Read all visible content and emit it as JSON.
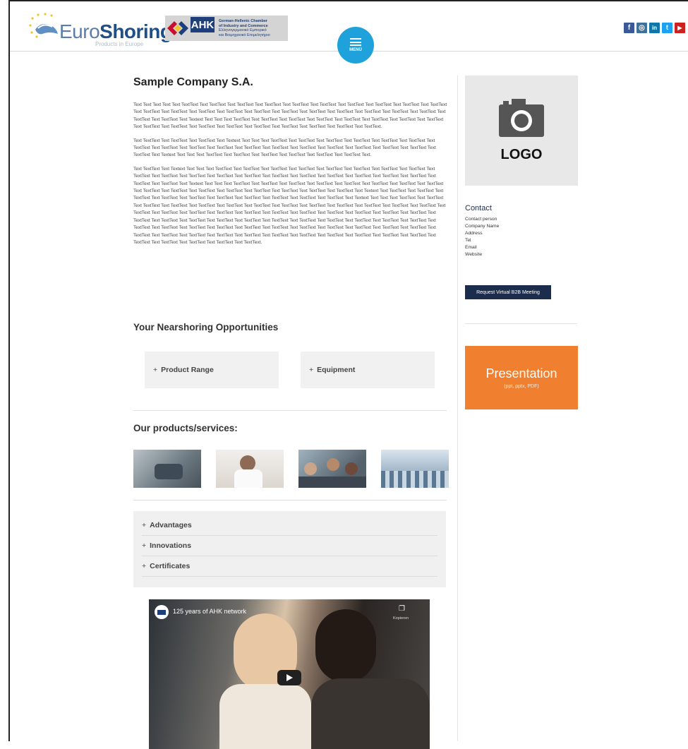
{
  "header": {
    "brand_euro": "Euro",
    "brand_shoring": "Shoring",
    "brand_tagline": "Products in Europe",
    "ahk_label": "AHK",
    "ahk_text_1": "German-Hellenic Chamber",
    "ahk_text_2": "of Industry and Commerce",
    "ahk_text_3": "Ελληνογερμανικό Εμπορικό",
    "ahk_text_4": "και Βιομηχανικό Επιμελητήριο",
    "menu_label": "MENÜ",
    "social": [
      {
        "icon": "facebook-icon",
        "glyph": "f",
        "color": "#3b5998"
      },
      {
        "icon": "instagram-icon",
        "glyph": "◎",
        "color": "#3f729b"
      },
      {
        "icon": "linkedin-icon",
        "glyph": "in",
        "color": "#0e76a8"
      },
      {
        "icon": "twitter-icon",
        "glyph": "t",
        "color": "#1da1f2"
      },
      {
        "icon": "youtube-icon",
        "glyph": "▶",
        "color": "#cd201f"
      }
    ]
  },
  "company": {
    "name": "Sample Company S.A.",
    "paragraphs": [
      "Text Text Text Text Text TextText Text TextText Text TextText Text TextText Text TextText Text TextText Text TextText Text TextText Text TextText Text TextText Text TextText Text TextText Text TextText Text TextText Text TextText Text TextText Text TextText Text TextText Text TextText Text TextText Text TextText Text TextText Text TextText Text Textext Text Text Text TextText Text TextText Text TextText Text TextText Text TextText Text TextText Text TextText Text TextText Text TextText Text TextText Text TextText Text TextText Text TextText Text TextText Text TextText Text TextText Text TextText.",
      "Text TextText Text TextText Text TextText Text Textext Text Text Text TextText Text TextText Text TextText Text TextText Text TextText Text TextText Text TextText Text TextText Text TextText Text TextText Text TextText Text TextText Text TextText Text TextText Text TextText Text TextText Text TextText Text TextText Text Textext Text Text Text TextText Text TextText Text TextText Text TextText Text TextText Text TextText Text.",
      "Text TextText Text Textext Text Text Text TextText Text TextText Text TextText Text TextText Text TextText Text TextText Text TextText Text TextText Text TextText Text TextText Text TextText Text TextText Text TextText Text TextText Text TextText Text TextText Text TextText Text TextText Text TextText Text TextText Text TextText Text Textext Text Text Text TextText Text TextText Text TextText Text TextText Text TextText Text TextText Text TextText Text TextText Text TextText Text TextText Text TextText Text TextText Text TextText Text TextText Text TextText Text TextText Text Textext Text TextText Text TextText Text TextText Text TextText Text TextText Text TextText Text TextText Text TextText Text TextText Text TextText Text Textext Text Text Text TextText Text TextText Text TextText Text TextText Text TextText Text TextText Text TextText Text TextText Text TextText Text TextText Text TextText Text TextText Text TextText Text TextText Text TextText Text TextText Text TextText Text TextText Text TextText Text TextText Text TextText Text TextText Text TextText Text TextText Text TextText Text TextText Text TextText Text TextText Text TextText Text TextText Text TextText Text TextText Text TextText Text TextText Text TextText Text TextText Text TextText Text TextText Text TextText Text TextText Text TextText Text TextText Text TextText Text TextText Text TextText Text TextText Text TextText Text TextText Text TextText Text TextText Text TextText Text TextText Text TextText Text TextText Text TextText Text TextText Text TextText Text TextText Text TextText Text TextText Text TextText Text TextText."
    ]
  },
  "nearshoring": {
    "heading": "Your Nearshoring Opportunities",
    "cards": [
      {
        "label": "Product Range"
      },
      {
        "label": "Equipment"
      }
    ]
  },
  "products": {
    "heading": "Our products/services:"
  },
  "accordion": {
    "items": [
      {
        "label": "Advantages"
      },
      {
        "label": "Innovations"
      },
      {
        "label": "Certificates"
      }
    ]
  },
  "video": {
    "title": "125 years of AHK network",
    "copy_label": "Kopieren"
  },
  "sidebar": {
    "logo_label": "LOGO",
    "contact_heading": "Contact",
    "contact_fields": [
      "Contact person",
      "Company Name",
      "Address",
      "Tel",
      "Email",
      "Website"
    ],
    "request_button": "Request Virtual B2B Meeting",
    "presentation_title": "Presentation",
    "presentation_formats": "(ppt, pptx, PDF)"
  },
  "plus_glyph": "+"
}
